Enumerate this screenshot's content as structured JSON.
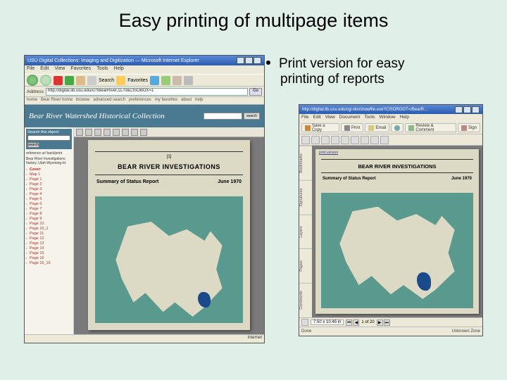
{
  "slide": {
    "title": "Easy printing of multipage items",
    "bullet_line1": "Print version for easy",
    "bullet_line2": "printing of reports"
  },
  "browser": {
    "window_title": "USU Digital Collections: Imaging and Digitization — Microsoft Internet Explorer",
    "menu": [
      "File",
      "Edit",
      "View",
      "Favorites",
      "Tools",
      "Help"
    ],
    "toolbar": {
      "back": "Back",
      "search": "Search",
      "favorites": "Favorites"
    },
    "address_label": "Address",
    "url": "http://digital.lib.usu.edu/u?/BearRiver,1170&CISOBOX=1",
    "go": "Go",
    "nav_links": [
      "home",
      "Bear River home",
      "browse",
      "advanced search",
      "preferences",
      "my favorites",
      "about",
      "help"
    ],
    "banner": "Bear River Watershed Historical Collection",
    "search_btn": "search",
    "sidebar": {
      "search_label": "Search this object:",
      "go": "search",
      "tabs": "reference url   back/print",
      "doc_meta": "Bear River Investigations history, Utah-Wyoming-Id",
      "pages": [
        "Cover",
        "Map 1",
        "Page 1",
        "Page 2",
        "Page 3",
        "Page 4",
        "Page 5",
        "Page 6",
        "Page 7",
        "Page 8",
        "Page 9",
        "Page 10",
        "Page 10_1",
        "Page 11",
        "Page 12",
        "Page 13",
        "Page 14",
        "Page 15",
        "Page 16",
        "Page 16_16"
      ]
    },
    "doc": {
      "pgnum": "[1]",
      "title": "BEAR RIVER INVESTIGATIONS",
      "subtitle": "Summary of Status Report",
      "date": "June 1970"
    },
    "status_left": "",
    "status_right": "Internet"
  },
  "acrobat": {
    "window_title": "http://digital.lib.usu.edu/cgi-bin/showfile.exe?CISOROOT=/BearR...",
    "menu": [
      "File",
      "Edit",
      "View",
      "Document",
      "Tools",
      "Window",
      "Help"
    ],
    "buttons": {
      "save": "Save a Copy",
      "print": "Print",
      "email": "Email",
      "search": "Search",
      "review": "Review & Comment",
      "sign": "Sign"
    },
    "side_tabs": [
      "Bookmarks",
      "Signatures",
      "Layers",
      "Pages",
      "Comments"
    ],
    "doc": {
      "print_link": "print version",
      "title": "BEAR RIVER INVESTIGATIONS",
      "subtitle": "Summary of Status Report",
      "date": "June 1970"
    },
    "status": {
      "dims": "7.50 x 10.45 in",
      "page": "1 of 20",
      "done": "Done",
      "zone": "Unknown Zone"
    }
  }
}
